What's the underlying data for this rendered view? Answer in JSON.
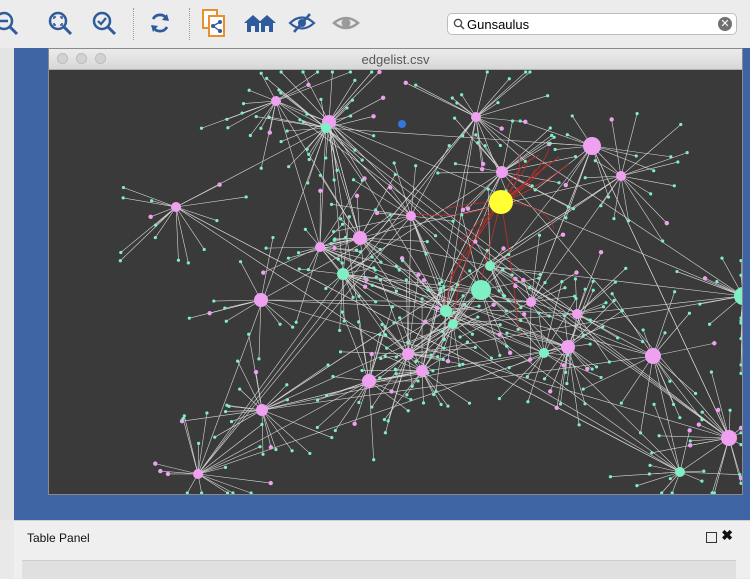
{
  "toolbar": {
    "icons": [
      "zoom-out-icon",
      "zoom-fit-icon",
      "zoom-selected-icon",
      "refresh-icon",
      "copy-network-icon",
      "home-icon",
      "hide-icon",
      "show-icon"
    ],
    "colors": {
      "blue": "#2f5b9c",
      "orange": "#e8902c"
    }
  },
  "search": {
    "value": "Gunsaulus",
    "clear_icon": "clear-icon"
  },
  "network_window": {
    "title": "edgelist.csv",
    "background": "#3a3a3a",
    "colors": {
      "edge": "#d9d9d9",
      "selected_edge": "#c0302c",
      "pink_node": "#f0a0f0",
      "green_node": "#7ef0c4",
      "selected_node": "#ffff33",
      "blue_node": "#3377dd"
    }
  },
  "table_panel": {
    "title": "Table Panel"
  }
}
